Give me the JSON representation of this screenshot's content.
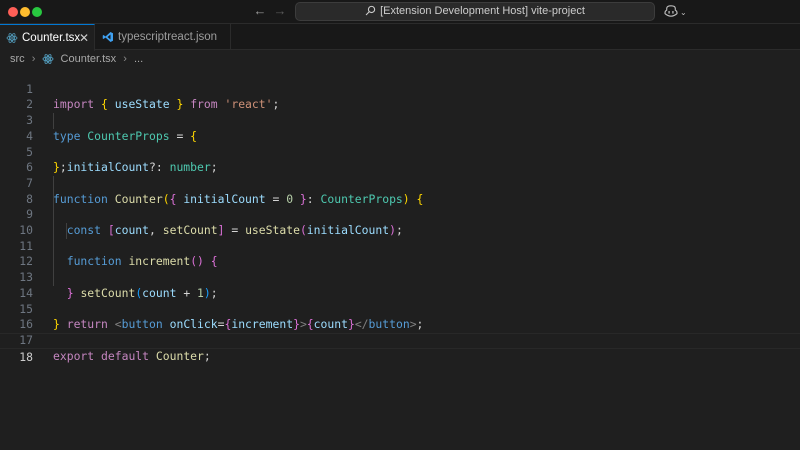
{
  "titlebar": {
    "command_center": "[Extension Development Host] vite-project"
  },
  "tabs": [
    {
      "label": "Counter.tsx",
      "active": true,
      "icon": "react-icon"
    },
    {
      "label": "typescriptreact.json",
      "active": false,
      "icon": "vscode-icon"
    }
  ],
  "breadcrumb": {
    "folder": "src",
    "file": "Counter.tsx",
    "more": "..."
  },
  "editor": {
    "current_line": 18,
    "lines": [
      {
        "n": "1"
      },
      {
        "n": "2"
      },
      {
        "n": "3"
      },
      {
        "n": "4"
      },
      {
        "n": "5"
      },
      {
        "n": "6"
      },
      {
        "n": "7"
      },
      {
        "n": "8"
      },
      {
        "n": "9"
      },
      {
        "n": "10"
      },
      {
        "n": "11"
      },
      {
        "n": "12"
      },
      {
        "n": "13"
      },
      {
        "n": "14"
      },
      {
        "n": "15"
      },
      {
        "n": "16"
      },
      {
        "n": "17"
      },
      {
        "n": "18"
      }
    ],
    "tokens": {
      "l1": [
        "import",
        "{",
        "useState",
        "}",
        "from",
        "'react'",
        ";"
      ],
      "l3": [
        "type",
        "CounterProps",
        "=",
        "{"
      ],
      "l4": [
        "initialCount",
        "?:",
        "number",
        ";"
      ],
      "l5": [
        "}",
        ";"
      ],
      "l7": [
        "function",
        "Counter",
        "(",
        "{",
        "initialCount",
        "=",
        "0",
        "}",
        ":",
        "CounterProps",
        ")",
        "{"
      ],
      "l8": [
        "const",
        "[",
        "count",
        ",",
        "setCount",
        "]",
        "=",
        "useState",
        "(",
        "initialCount",
        ")",
        ";"
      ],
      "l10": [
        "function",
        "increment",
        "(",
        ")",
        "{"
      ],
      "l11": [
        "setCount",
        "(",
        "count",
        "+",
        "1",
        ")",
        ";"
      ],
      "l12": [
        "}"
      ],
      "l14": [
        "return",
        "<",
        "button",
        "onClick",
        "=",
        "{",
        "increment",
        "}",
        ">",
        "{",
        "count",
        "}",
        "</",
        "button",
        ">",
        ";"
      ],
      "l15": [
        "}"
      ],
      "l17": [
        "export",
        "default",
        "Counter",
        ";"
      ]
    }
  },
  "colors": {
    "accent": "#0078d4",
    "editor_bg": "#1f1f1f",
    "traffic_close": "#ff5f57",
    "traffic_min": "#febc2e",
    "traffic_max": "#28c840"
  }
}
